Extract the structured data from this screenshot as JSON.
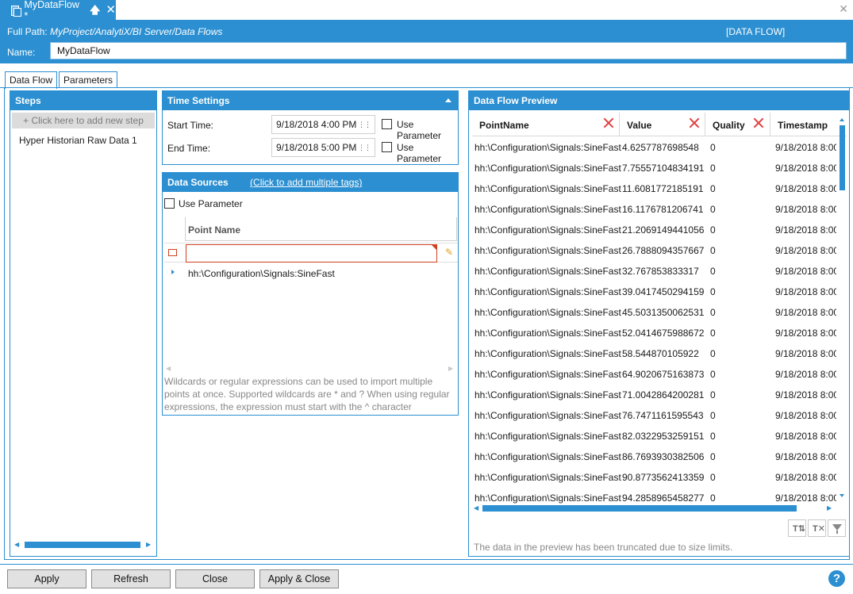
{
  "document_tab": {
    "title": "MyDataFlow *"
  },
  "header": {
    "full_path_label": "Full Path:",
    "full_path_value": "MyProject/AnalytiX/BI Server/Data Flows",
    "type_label": "[DATA FLOW]",
    "name_label": "Name:",
    "name_value": "MyDataFlow"
  },
  "view_tabs": [
    "Data Flow",
    "Parameters"
  ],
  "steps": {
    "title": "Steps",
    "add_step": "+  Click here to add new step",
    "items": [
      "Hyper Historian Raw Data  1"
    ]
  },
  "time_settings": {
    "title": "Time Settings",
    "start_label": "Start Time:",
    "start_value": "9/18/2018 4:00 PM",
    "end_label": "End Time:",
    "end_value": "9/18/2018 5:00 PM",
    "use_parameter": "Use Parameter"
  },
  "data_sources": {
    "title": "Data Sources",
    "link": "(Click to add multiple tags)",
    "use_parameter": "Use Parameter",
    "column": "Point Name",
    "rows": [
      "hh:\\Configuration\\Signals:SineFast"
    ],
    "hint": "Wildcards or regular expressions can be used to import multiple points at once. Supported wildcards are * and ? When using regular expressions, the expression must start with the ^ character"
  },
  "preview": {
    "title": "Data Flow Preview",
    "columns": [
      "PointName",
      "Value",
      "Quality",
      "Timestamp"
    ],
    "rows": [
      [
        "hh:\\Configuration\\Signals:SineFast",
        "4.6257787698548",
        "0",
        "9/18/2018 8:00"
      ],
      [
        "hh:\\Configuration\\Signals:SineFast",
        "7.75557104834191",
        "0",
        "9/18/2018 8:00"
      ],
      [
        "hh:\\Configuration\\Signals:SineFast",
        "11.6081772185191",
        "0",
        "9/18/2018 8:00"
      ],
      [
        "hh:\\Configuration\\Signals:SineFast",
        "16.1176781206741",
        "0",
        "9/18/2018 8:00"
      ],
      [
        "hh:\\Configuration\\Signals:SineFast",
        "21.2069149441056",
        "0",
        "9/18/2018 8:00"
      ],
      [
        "hh:\\Configuration\\Signals:SineFast",
        "26.7888094357667",
        "0",
        "9/18/2018 8:00"
      ],
      [
        "hh:\\Configuration\\Signals:SineFast",
        "32.767853833317",
        "0",
        "9/18/2018 8:00"
      ],
      [
        "hh:\\Configuration\\Signals:SineFast",
        "39.0417450294159",
        "0",
        "9/18/2018 8:00"
      ],
      [
        "hh:\\Configuration\\Signals:SineFast",
        "45.5031350062531",
        "0",
        "9/18/2018 8:00"
      ],
      [
        "hh:\\Configuration\\Signals:SineFast",
        "52.0414675988672",
        "0",
        "9/18/2018 8:00"
      ],
      [
        "hh:\\Configuration\\Signals:SineFast",
        "58.544870105922",
        "0",
        "9/18/2018 8:00"
      ],
      [
        "hh:\\Configuration\\Signals:SineFast",
        "64.9020675163873",
        "0",
        "9/18/2018 8:00"
      ],
      [
        "hh:\\Configuration\\Signals:SineFast",
        "71.0042864200281",
        "0",
        "9/18/2018 8:00"
      ],
      [
        "hh:\\Configuration\\Signals:SineFast",
        "76.7471161595543",
        "0",
        "9/18/2018 8:00"
      ],
      [
        "hh:\\Configuration\\Signals:SineFast",
        "82.0322953259151",
        "0",
        "9/18/2018 8:00"
      ],
      [
        "hh:\\Configuration\\Signals:SineFast",
        "86.7693930382506",
        "0",
        "9/18/2018 8:00"
      ],
      [
        "hh:\\Configuration\\Signals:SineFast",
        "90.8773562413359",
        "0",
        "9/18/2018 8:00"
      ],
      [
        "hh:\\Configuration\\Signals:SineFast",
        "94.2858965458277",
        "0",
        "9/18/2018 8:00"
      ]
    ],
    "note": "The data in the preview has been truncated due to size limits."
  },
  "buttons": {
    "apply": "Apply",
    "refresh": "Refresh",
    "close": "Close",
    "apply_close": "Apply & Close"
  },
  "help": "?"
}
